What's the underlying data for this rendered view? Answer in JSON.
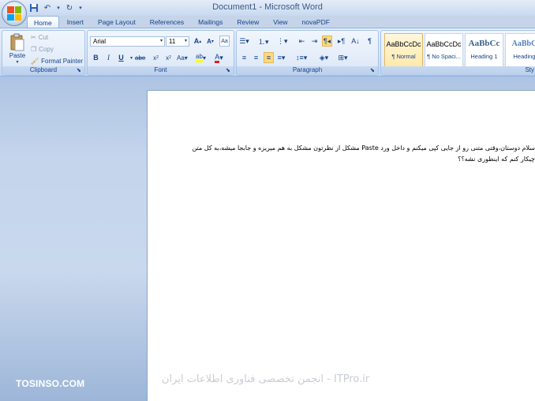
{
  "window": {
    "title": "Document1 - Microsoft Word"
  },
  "qat": {
    "save_icon": "save-icon",
    "undo_icon": "undo-icon",
    "redo_icon": "redo-icon"
  },
  "tabs": [
    {
      "label": "Home",
      "active": true
    },
    {
      "label": "Insert"
    },
    {
      "label": "Page Layout"
    },
    {
      "label": "References"
    },
    {
      "label": "Mailings"
    },
    {
      "label": "Review"
    },
    {
      "label": "View"
    },
    {
      "label": "novaPDF"
    }
  ],
  "clipboard": {
    "label": "Clipboard",
    "paste": "Paste",
    "cut": "Cut",
    "copy": "Copy",
    "format_painter": "Format Painter"
  },
  "font": {
    "label": "Font",
    "family": "Arial",
    "size": "11"
  },
  "paragraph": {
    "label": "Paragraph"
  },
  "styles": {
    "label": "Sty",
    "items": [
      {
        "sample": "AaBbCcDc",
        "name": "¶ Normal"
      },
      {
        "sample": "AaBbCcDc",
        "name": "¶ No Spaci..."
      },
      {
        "sample": "AaBbCc",
        "name": "Heading 1"
      },
      {
        "sample": "AaBbC",
        "name": "Heading"
      }
    ]
  },
  "document": {
    "line1": "سلام دوستان،وقتی متنی رو از جایی کپی میکنم و داخل ورد Paste مشکل از نظرتون مشکل به هم میریزه و جابجا میشه،به کل متن",
    "line2": "چیکار کنم که اینطوری نشه؟؟"
  },
  "watermarks": {
    "left": "TOSINSO.COM",
    "right": "ITPro.ir - انجمن تخصصی فناوری اطلاعات ایران"
  }
}
